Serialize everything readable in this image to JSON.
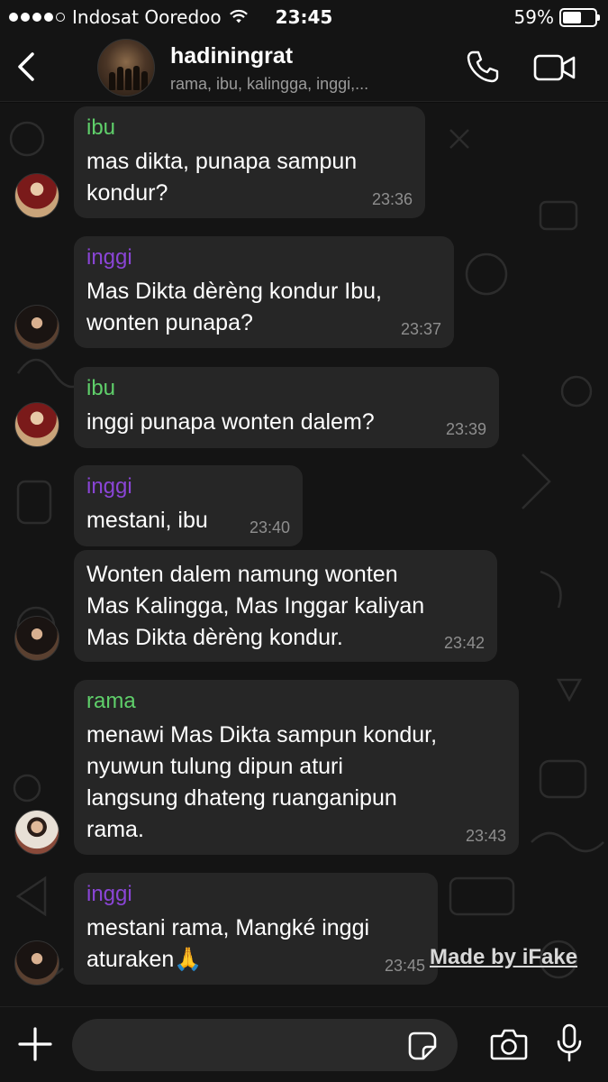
{
  "status_bar": {
    "carrier": "Indosat Ooredoo",
    "time": "23:45",
    "battery": "59%",
    "battery_level": 0.59,
    "signal_bars": 4
  },
  "header": {
    "title": "hadiningrat",
    "subtitle": "rama, ibu, kalingga, inggi,...",
    "icons": [
      "back-chevron",
      "group-avatar",
      "phone-call",
      "video-call"
    ]
  },
  "messages": [
    {
      "sender": "ibu",
      "lines": [
        "mas dikta, punapa sampun",
        "kondur?"
      ],
      "time": "23:36"
    },
    {
      "sender": "inggi",
      "lines": [
        "Mas Dikta dèrèng kondur Ibu,",
        "wonten punapa?"
      ],
      "time": "23:37"
    },
    {
      "sender": "ibu",
      "lines": [
        "inggi punapa wonten dalem?"
      ],
      "time": "23:39"
    },
    {
      "sender": "inggi",
      "lines": [
        "mestani, ibu"
      ],
      "time": "23:40"
    },
    {
      "sender": "",
      "lines": [
        "Wonten dalem namung wonten",
        "Mas Kalingga, Mas Inggar kaliyan",
        "Mas Dikta dèrèng kondur."
      ],
      "time": "23:42"
    },
    {
      "sender": "rama",
      "lines": [
        "menawi Mas Dikta sampun kondur,",
        "nyuwun tulung dipun aturi",
        "langsung dhateng ruanganipun",
        "rama."
      ],
      "time": "23:43"
    },
    {
      "sender": "inggi",
      "lines": [
        "mestani rama, Mangké inggi",
        "aturaken🙏"
      ],
      "time": "23:45"
    }
  ],
  "watermark": "Made by iFake",
  "input_bar": {
    "icons": [
      "plus-icon",
      "sticker-icon",
      "camera-icon",
      "microphone-icon"
    ]
  }
}
